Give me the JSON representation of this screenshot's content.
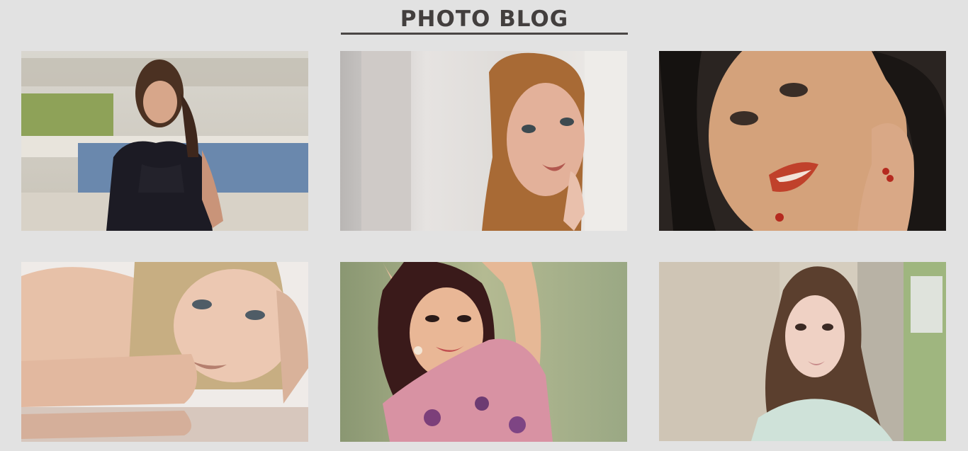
{
  "header": {
    "title": "PHOTO BLOG",
    "underline_color": "#4a4645"
  },
  "gallery": {
    "photos": [
      {
        "subject": "portrait-woman-dark-hair-waterfront"
      },
      {
        "subject": "portrait-woman-auburn-hair-behind-wall"
      },
      {
        "subject": "closeup-woman-dark-hair-red-lips"
      },
      {
        "subject": "portrait-woman-blonde-hair-reflection"
      },
      {
        "subject": "portrait-woman-smiling-floral-top"
      },
      {
        "subject": "portrait-woman-long-brown-wavy-hair"
      }
    ]
  },
  "colors": {
    "background": "#e2e2e2",
    "title_text": "#433f3e"
  }
}
